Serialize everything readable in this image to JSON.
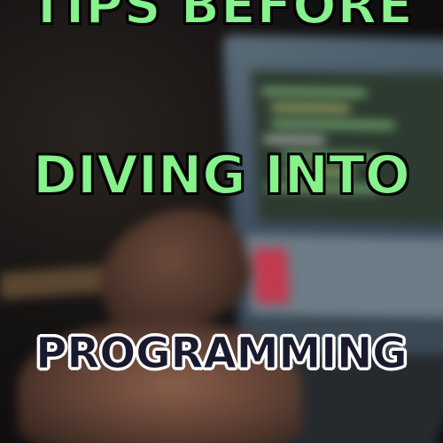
{
  "overlay": {
    "line1": "TIPS BEFORE",
    "line2": "DIVING INTO",
    "line3": "PROGRAMMING"
  },
  "colors": {
    "headline_green": "#86f28b",
    "headline_dark": "#1a1a2e",
    "outline_white": "#ffffff",
    "code_red": "#c23a4e"
  }
}
